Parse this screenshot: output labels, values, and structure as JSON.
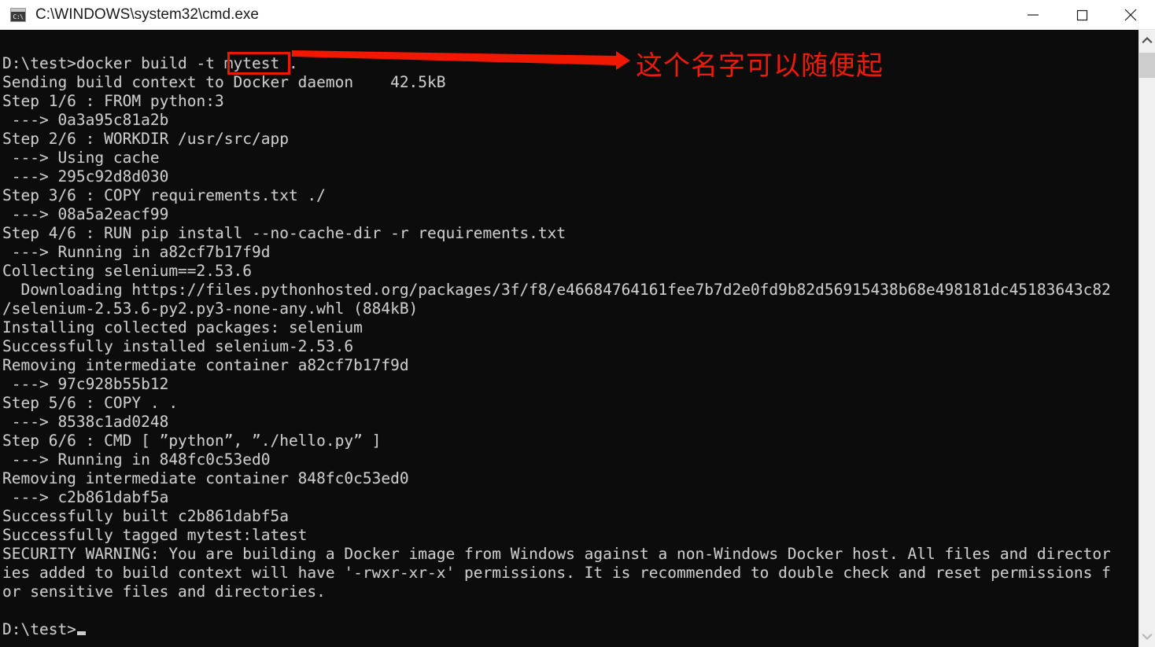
{
  "window": {
    "title": "C:\\WINDOWS\\system32\\cmd.exe",
    "icon": "cmd-icon",
    "icon_glyph": "C:\\",
    "controls": {
      "minimize_label": "Minimize",
      "maximize_label": "Maximize",
      "close_label": "Close"
    }
  },
  "colors": {
    "titlebar_bg": "#ffffff",
    "console_bg": "#0c0c0c",
    "console_fg": "#cccccc",
    "annotation_red": "#ee1b0a",
    "highlight_red": "#e81b00",
    "scrollbar_track": "#f0f0f0",
    "scrollbar_thumb": "#cdcdcd"
  },
  "console": {
    "lines": [
      "D:\\test>docker build -t mytest .",
      "Sending build context to Docker daemon    42.5kB",
      "Step 1/6 : FROM python:3",
      " ---> 0a3a95c81a2b",
      "Step 2/6 : WORKDIR /usr/src/app",
      " ---> Using cache",
      " ---> 295c92d8d030",
      "Step 3/6 : COPY requirements.txt ./",
      " ---> 08a5a2eacf99",
      "Step 4/6 : RUN pip install --no-cache-dir -r requirements.txt",
      " ---> Running in a82cf7b17f9d",
      "Collecting selenium==2.53.6",
      "  Downloading https://files.pythonhosted.org/packages/3f/f8/e46684764161fee7b7d2e0fd9b82d56915438b68e498181dc45183643c82",
      "/selenium-2.53.6-py2.py3-none-any.whl (884kB)",
      "Installing collected packages: selenium",
      "Successfully installed selenium-2.53.6",
      "Removing intermediate container a82cf7b17f9d",
      " ---> 97c928b55b12",
      "Step 5/6 : COPY . .",
      " ---> 8538c1ad0248",
      "Step 6/6 : CMD [ ”python”, ”./hello.py” ]",
      " ---> Running in 848fc0c53ed0",
      "Removing intermediate container 848fc0c53ed0",
      " ---> c2b861dabf5a",
      "Successfully built c2b861dabf5a",
      "Successfully tagged mytest:latest",
      "SECURITY WARNING: You are building a Docker image from Windows against a non-Windows Docker host. All files and director",
      "ies added to build context will have '-rwxr-xr-x' permissions. It is recommended to double check and reset permissions f",
      "or sensitive files and directories.",
      ""
    ],
    "prompt": "D:\\test>",
    "cursor": "block-cursor"
  },
  "annotation": {
    "text": "这个名字可以随便起",
    "highlighted_token": "mytest",
    "arrow": "red-arrow-right"
  },
  "scrollbar": {
    "up_arrow": "chevron-up-icon",
    "down_arrow": "chevron-down-icon",
    "position": "top"
  }
}
